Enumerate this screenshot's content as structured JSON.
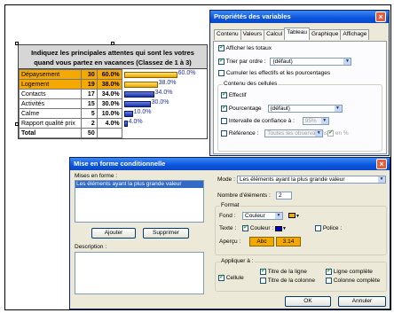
{
  "table": {
    "title_line1": "Indiquez les  principales attentes qui sont les votres",
    "title_line2": "quand vous partez en vacances (Classez de 1 à 3)",
    "rows": [
      {
        "label": "Dépaysement",
        "count": "30",
        "pct": "60.0%",
        "value": 60.0,
        "highlight": true
      },
      {
        "label": "Logement",
        "count": "19",
        "pct": "38.0%",
        "value": 38.0,
        "highlight": true
      },
      {
        "label": "Contacts",
        "count": "17",
        "pct": "34.0%",
        "value": 34.0,
        "highlight": false
      },
      {
        "label": "Activités",
        "count": "15",
        "pct": "30.0%",
        "value": 30.0,
        "highlight": false
      },
      {
        "label": "Calme",
        "count": "5",
        "pct": "10.0%",
        "value": 10.0,
        "highlight": false
      },
      {
        "label": "Rapport qualité prix",
        "count": "2",
        "pct": "4.0%",
        "value": 4.0,
        "highlight": false
      }
    ],
    "total_label": "Total",
    "total_count": "50",
    "highlight_color": "#f5a800",
    "bar_color": "#1a2fa8"
  },
  "props": {
    "title": "Propriétés des variables",
    "close": "×",
    "tabs": [
      "Contenu",
      "Valeurs",
      "Calcul",
      "Tableau",
      "Graphique",
      "Affichage"
    ],
    "active_tab": "Tableau",
    "afficher_totaux": "Afficher les totaux",
    "trier_label": "Trier par ordre :",
    "trier_value": "(défaut)",
    "cumuler": "Cumuler les effectifs et les pourcentages",
    "contenu_cellules": "Contenu des cellules",
    "effectif": "Effectif",
    "pourcentage": "Pourcentage",
    "pourcentage_value": "(défaut)",
    "intervalle": "Intervalle de confiance à :",
    "intervalle_value": "95%",
    "reference": "Référence :",
    "reference_value": "Toutes les observations",
    "en_pct": "en %"
  },
  "mef": {
    "title": "Mise en forme conditionnelle",
    "close": "×",
    "mises_en_forme": "Mises en forme :",
    "list_item": "Les éléments ayant la plus grande valeur",
    "ajouter": "Ajouter",
    "supprimer": "Supprimer",
    "description": "Description :",
    "mode_label": "Mode :",
    "mode_value": "Les éléments ayant la plus grande valeur",
    "nb_label": "Nombre d'éléments :",
    "nb_value": "2",
    "format": "Format",
    "fond_label": "Fond :",
    "fond_value": "Couleur",
    "fond_color": "#f5a800",
    "texte_label": "Texte :",
    "couleur": "Couleur :",
    "texte_color": "#0000cc",
    "police": "Police :",
    "apercu_label": "Aperçu :",
    "apercu_abc": "Abc",
    "apercu_num": "3.14",
    "appliquer": "Appliquer à :",
    "cellule": "Cellule",
    "titre_ligne": "Titre de la ligne",
    "titre_colonne": "Titre de la colonne",
    "ligne_complete": "Ligne complète",
    "colonne_complete": "Colonne complète",
    "ok": "OK",
    "annuler": "Annuler"
  }
}
